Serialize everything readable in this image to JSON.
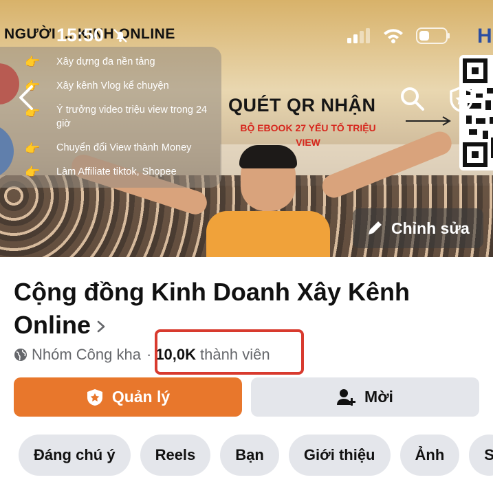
{
  "status_bar": {
    "time": "15:50"
  },
  "cover": {
    "brand_text": "NGƯỜI ... KINH ONLINE",
    "logo_letter": "H",
    "features": [
      "Xây dựng đa nền tảng",
      "Xây kênh Vlog kể chuyện",
      "Ý trưởng video triệu view trong 24 giờ",
      "Chuyển đổi View thành Money",
      "Làm Affiliate tiktok, Shopee"
    ],
    "qr_title": "QUÉT QR NHẬN",
    "qr_subtitle": "BỘ EBOOK 27 YẾU TỐ TRIỆU VIEW",
    "edit_label": "Chỉnh sửa"
  },
  "group": {
    "name": "Cộng đồng Kinh Doanh Xây Kênh Online",
    "privacy": "Nhóm Công kha",
    "separator": "·",
    "member_count": "10,0K",
    "member_label": "thành viên"
  },
  "actions": {
    "manage_label": "Quản lý",
    "invite_label": "Mời"
  },
  "tabs": [
    "Đáng chú ý",
    "Reels",
    "Bạn",
    "Giới thiệu",
    "Ảnh",
    "S"
  ],
  "colors": {
    "accent": "#E8772C",
    "highlight_border": "#D83A2E",
    "secondary_btn": "#E4E6EB"
  }
}
